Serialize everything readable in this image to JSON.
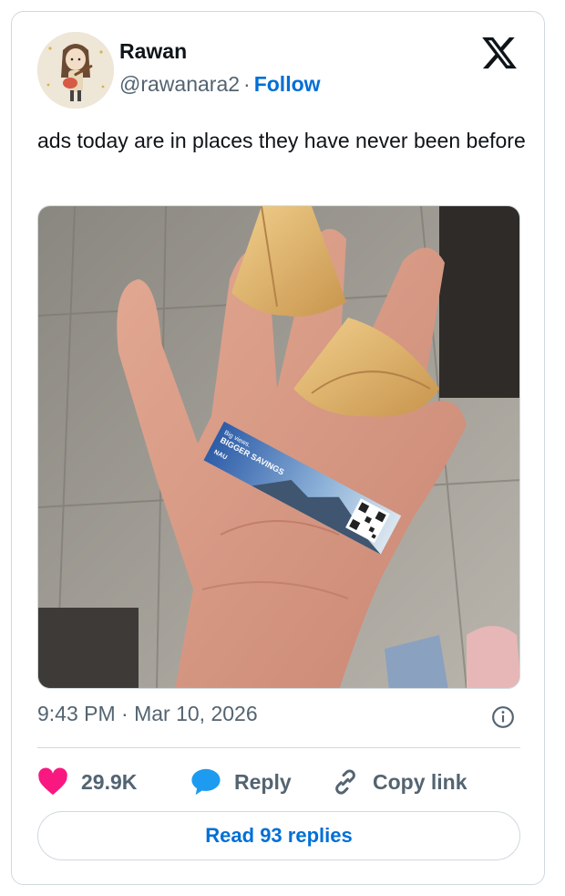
{
  "author": {
    "name": "Rawan",
    "handle": "@rawanara2",
    "separator": "·",
    "follow_label": "Follow"
  },
  "tweet": {
    "text": "ads today are in places they have never been before",
    "timestamp": "9:43 PM · Mar 10, 2026"
  },
  "media": {
    "ad_slip": {
      "line1": "Big views.",
      "headline": "BIGGER SAVINGS",
      "brand": "NAU"
    }
  },
  "actions": {
    "like_count": "29.9K",
    "reply_label": "Reply",
    "copy_label": "Copy link"
  },
  "footer": {
    "read_replies_label": "Read 93 replies"
  },
  "colors": {
    "link": "#006fd6",
    "like": "#f91880",
    "reply": "#1d9bf0",
    "secondary_text": "#536471",
    "border": "#cfd9de"
  },
  "icons": [
    "x-logo-icon",
    "info-icon",
    "heart-icon",
    "reply-bubble-icon",
    "link-icon"
  ]
}
